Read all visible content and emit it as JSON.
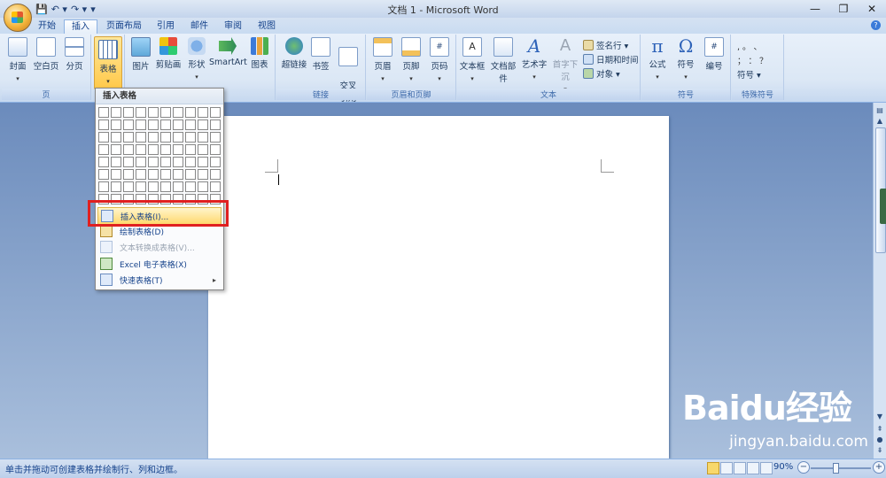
{
  "window": {
    "title": "文档 1 - Microsoft Word",
    "minimize": "—",
    "restore": "❐",
    "close": "✕"
  },
  "qat": {
    "save": "💾",
    "undo": "↶ ▾",
    "redo": "↷ ▾",
    "customize": "▾"
  },
  "tabs": [
    "开始",
    "插入",
    "页面布局",
    "引用",
    "邮件",
    "审阅",
    "视图"
  ],
  "active_tab": "插入",
  "ribbon": {
    "groups": {
      "pages": {
        "label": "页",
        "buttons": [
          "封面",
          "空白页",
          "分页"
        ]
      },
      "tables": {
        "label": "",
        "buttons": [
          "表格"
        ]
      },
      "illustrations": {
        "label": "",
        "buttons": [
          "图片",
          "剪贴画",
          "形状",
          "SmartArt",
          "图表"
        ]
      },
      "links": {
        "label": "链接",
        "buttons": [
          "超链接",
          "书签",
          "交叉\n引用"
        ]
      },
      "header_footer": {
        "label": "页眉和页脚",
        "buttons": [
          "页眉",
          "页脚",
          "页码"
        ]
      },
      "text": {
        "label": "文本",
        "buttons": [
          "文本框",
          "文档部件",
          "艺术字",
          "首字下沉"
        ],
        "small": [
          "签名行 ▾",
          "日期和时间",
          "对象 ▾"
        ]
      },
      "symbols": {
        "label": "符号",
        "buttons": [
          "公式",
          "符号",
          "编号"
        ]
      },
      "special": {
        "label": "特殊符号",
        "items": [
          ", 。 、",
          "； ： ？",
          "符号 ▾"
        ]
      }
    }
  },
  "dropdown": {
    "header": "插入表格",
    "grid_cols": 10,
    "grid_rows": 8,
    "items": [
      {
        "label": "插入表格(I)...",
        "highlighted": true,
        "disabled": false
      },
      {
        "label": "绘制表格(D)",
        "highlighted": false,
        "disabled": false
      },
      {
        "label": "文本转换成表格(V)...",
        "highlighted": false,
        "disabled": true
      },
      {
        "label": "Excel 电子表格(X)",
        "highlighted": false,
        "disabled": false
      },
      {
        "label": "快速表格(T)",
        "highlighted": false,
        "disabled": false,
        "submenu": "▸"
      }
    ]
  },
  "status": {
    "text": "单击并拖动可创建表格并绘制行、列和边框。",
    "zoom": "90%",
    "zoom_minus": "−",
    "zoom_plus": "+"
  },
  "watermark": {
    "brand": "Baidu经验",
    "url": "jingyan.baidu.com"
  },
  "colors": {
    "accent": "#15428b",
    "highlight": "#ffd86e",
    "annotation": "#e02020"
  }
}
